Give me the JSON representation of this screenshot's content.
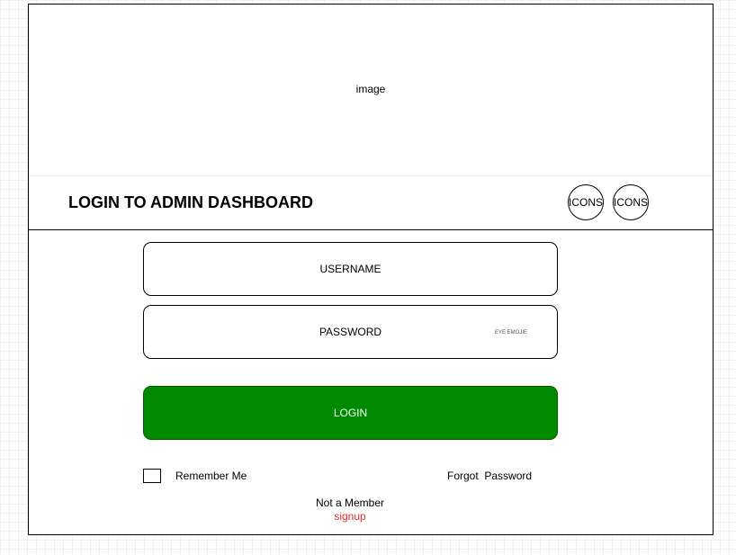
{
  "hero": {
    "image_label": "image"
  },
  "header": {
    "title": "LOGIN TO ADMIN DASHBOARD",
    "icons": [
      {
        "label": "ICONS",
        "icon": "placeholder-icon"
      },
      {
        "label": "ICONS",
        "icon": "placeholder-icon"
      }
    ]
  },
  "form": {
    "username": {
      "placeholder": "USERNAME",
      "value": ""
    },
    "password": {
      "placeholder": "PASSWORD",
      "value": "",
      "toggle_label": "EYE EMOJIE"
    },
    "login_label": "LOGIN",
    "remember_me": {
      "label": "Remember Me",
      "checked": false
    },
    "forgot_password_label": "Forgot  Password"
  },
  "footer": {
    "not_member_text": "Not a Member",
    "signup_label": "signup"
  },
  "colors": {
    "login_button": "#008a00",
    "signup_link": "#e03030"
  }
}
